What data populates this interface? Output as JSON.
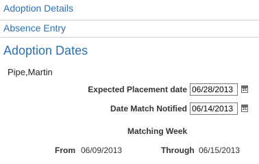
{
  "links": {
    "adoption_details": "Adoption Details",
    "absence_entry": "Absence Entry"
  },
  "page_title": "Adoption Dates",
  "person_name": "Pipe,Martin",
  "fields": {
    "expected_placement": {
      "label": "Expected Placement date",
      "value": "06/28/2013"
    },
    "date_match_notified": {
      "label": "Date Match Notified",
      "value": "06/14/2013"
    }
  },
  "matching_week": {
    "heading": "Matching Week",
    "from_label": "From",
    "from_value": "06/09/2013",
    "through_label": "Through",
    "through_value": "06/15/2013"
  },
  "icons": {
    "calendar": "calendar-icon",
    "calendar_glyph": "31"
  },
  "colors": {
    "link": "#2a6fb3",
    "title": "#2a6fb3"
  }
}
